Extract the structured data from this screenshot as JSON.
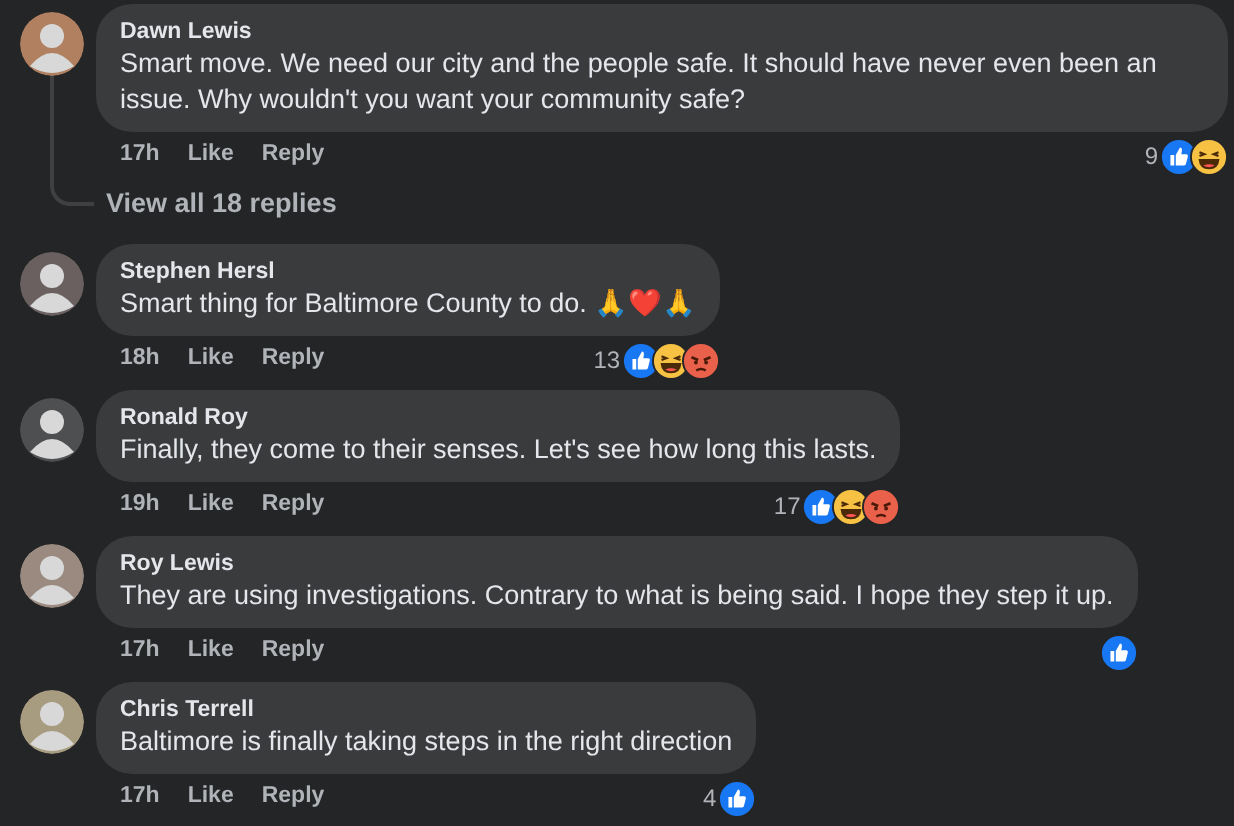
{
  "comments": [
    {
      "author": "Dawn Lewis",
      "text": "Smart move. We need our city and the people safe. It should have never even been an issue. Why wouldn't you want your community safe?",
      "time": "17h",
      "like": "Like",
      "reply": "Reply",
      "reaction_count": "9",
      "reactions": [
        {
          "kind": "like"
        },
        {
          "kind": "haha"
        }
      ],
      "thread": {
        "label": "View all 18 replies"
      }
    },
    {
      "author": "Stephen Hersl",
      "text": "Smart thing for Baltimore County to do. 🙏❤️🙏",
      "time": "18h",
      "like": "Like",
      "reply": "Reply",
      "reaction_count": "13",
      "reactions": [
        {
          "kind": "like"
        },
        {
          "kind": "haha"
        },
        {
          "kind": "angry"
        }
      ]
    },
    {
      "author": "Ronald Roy",
      "text": "Finally, they come to their senses. Let's see how long this lasts.",
      "time": "19h",
      "like": "Like",
      "reply": "Reply",
      "reaction_count": "17",
      "reactions": [
        {
          "kind": "like"
        },
        {
          "kind": "haha"
        },
        {
          "kind": "angry"
        }
      ]
    },
    {
      "author": "Roy Lewis",
      "text": "They are using investigations. Contrary to what is being said. I hope they step it up.",
      "time": "17h",
      "like": "Like",
      "reply": "Reply",
      "reactions": [
        {
          "kind": "like"
        }
      ]
    },
    {
      "author": "Chris Terrell",
      "text": "Baltimore is finally taking steps in the right direction",
      "time": "17h",
      "like": "Like",
      "reply": "Reply",
      "reaction_count": "4",
      "reactions": [
        {
          "kind": "like"
        }
      ]
    }
  ]
}
